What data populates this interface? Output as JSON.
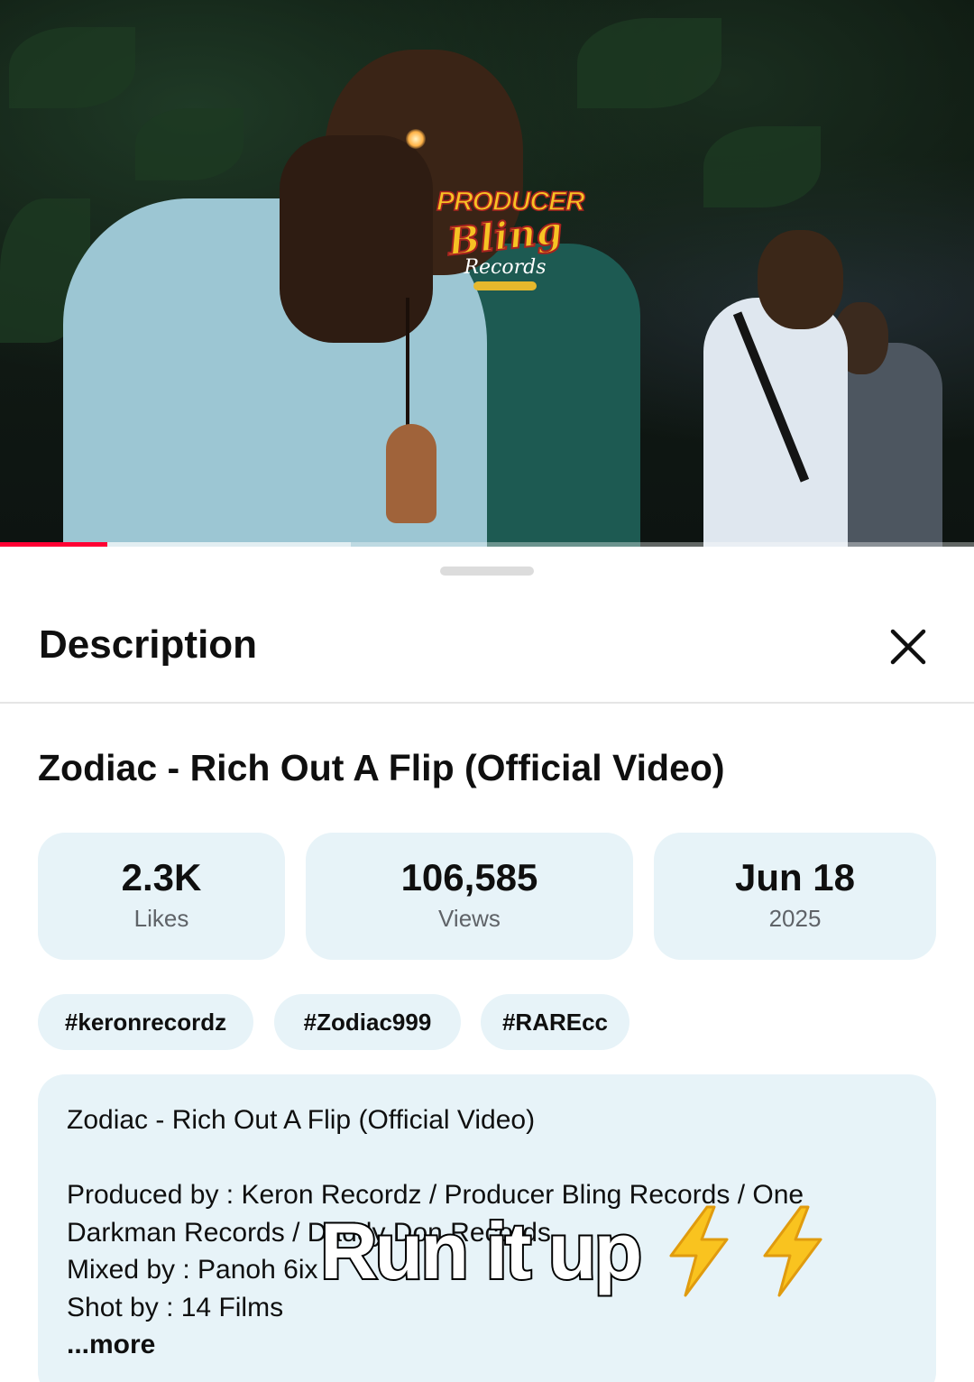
{
  "video": {
    "watermark": {
      "line1": "PRODUCER",
      "line2": "Bling",
      "line3": "Records"
    },
    "progress": {
      "played_fraction": 0.11,
      "buffered_fraction": 0.36
    }
  },
  "sheet": {
    "header_title": "Description",
    "video_title": "Zodiac - Rich Out A Flip (Official Video)",
    "stats": [
      {
        "value": "2.3K",
        "label": "Likes"
      },
      {
        "value": "106,585",
        "label": "Views"
      },
      {
        "value": "Jun 18",
        "label": "2025"
      }
    ],
    "tags": [
      "#keronrecordz",
      "#Zodiac999",
      "#RAREcc"
    ],
    "description": {
      "title_line": "Zodiac - Rich Out A Flip (Official Video)",
      "lines": [
        "Produced by : Keron Recordz / Producer Bling Records / One",
        "Darkman Records / Daddy Don Records",
        "Mixed by : Panoh 6ix",
        "Shot by : 14 Films"
      ],
      "more_label": "...more"
    }
  },
  "overlay": {
    "caption": "Run it up",
    "emoji_icon": "high-voltage-icon",
    "emoji_count": 2
  },
  "colors": {
    "card_bg": "#e7f3f8",
    "progress_red": "#ff0033",
    "bolt_yellow": "#f9c31f"
  }
}
